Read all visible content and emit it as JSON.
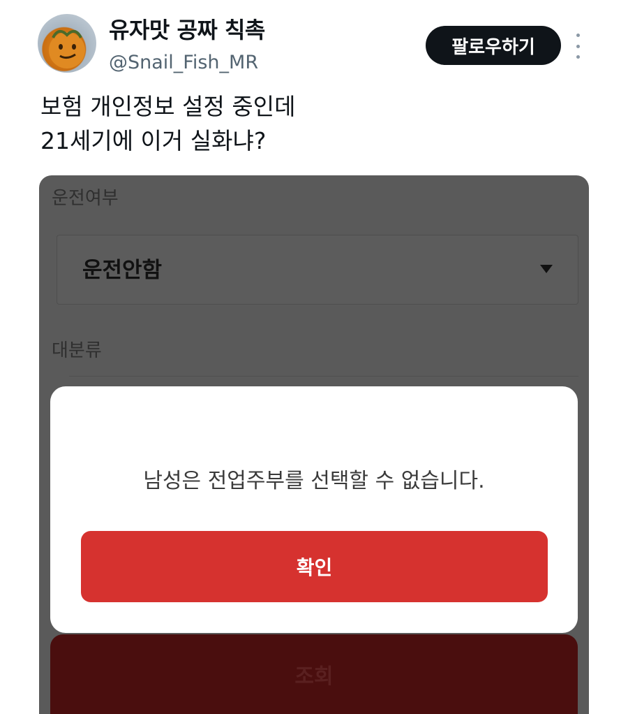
{
  "tweet": {
    "display_name": "유자맛 공짜 칙촉",
    "handle": "@Snail_Fish_MR",
    "follow_label": "팔로우하기",
    "text_lines": [
      "보험 개인정보 설정 중인데",
      "21세기에 이거 실화냐?"
    ]
  },
  "screenshot": {
    "driving_label": "운전여부",
    "driving_value": "운전안함",
    "category_label": "대분류",
    "dialog": {
      "message": "남성은 전업주부를 선택할 수 없습니다.",
      "confirm_label": "확인"
    },
    "query_label": "조회"
  },
  "colors": {
    "accent_red": "#d6322f",
    "follow_bg": "#0f1419",
    "overlay_gray": "#5a5a5a"
  }
}
